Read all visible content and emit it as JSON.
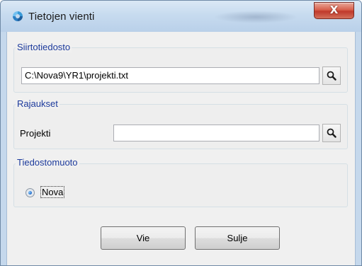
{
  "window": {
    "title": "Tietojen vienti",
    "close_symbol": "X"
  },
  "transfer_file": {
    "legend": "Siirtotiedosto",
    "path_value": "C:\\Nova9\\YR1\\projekti.txt",
    "browse_icon": "search-icon"
  },
  "limits": {
    "legend": "Rajaukset",
    "project_label": "Projekti",
    "project_value": "",
    "browse_icon": "search-icon"
  },
  "file_format": {
    "legend": "Tiedostomuoto",
    "options": [
      {
        "label": "Nova",
        "selected": true
      }
    ]
  },
  "buttons": {
    "export_label": "Vie",
    "close_label": "Sulje"
  },
  "colors": {
    "legend_text": "#1c3a9c",
    "close_button": "#c0392b",
    "title_bar": "#c7dbef"
  }
}
